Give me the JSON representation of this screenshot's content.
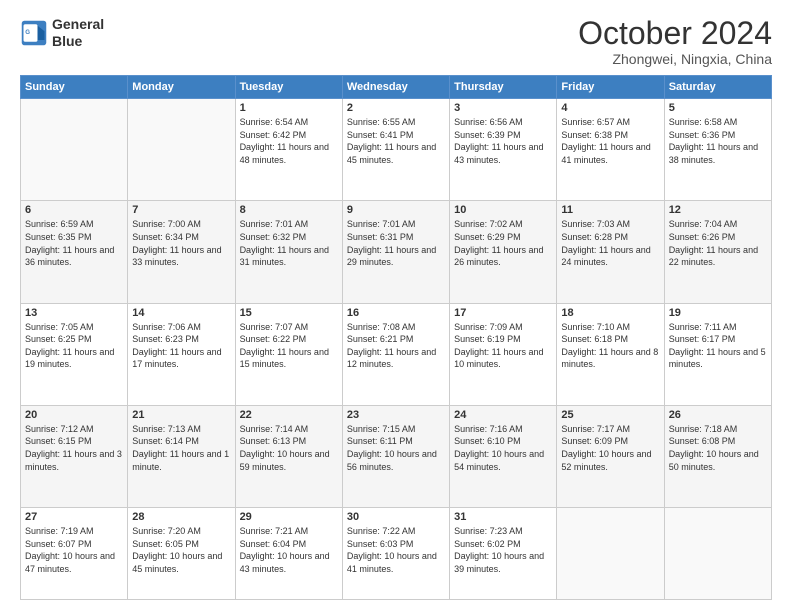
{
  "header": {
    "logo_line1": "General",
    "logo_line2": "Blue",
    "title": "October 2024",
    "location": "Zhongwei, Ningxia, China"
  },
  "days_of_week": [
    "Sunday",
    "Monday",
    "Tuesday",
    "Wednesday",
    "Thursday",
    "Friday",
    "Saturday"
  ],
  "weeks": [
    [
      {
        "day": "",
        "info": ""
      },
      {
        "day": "",
        "info": ""
      },
      {
        "day": "1",
        "info": "Sunrise: 6:54 AM\nSunset: 6:42 PM\nDaylight: 11 hours and 48 minutes."
      },
      {
        "day": "2",
        "info": "Sunrise: 6:55 AM\nSunset: 6:41 PM\nDaylight: 11 hours and 45 minutes."
      },
      {
        "day": "3",
        "info": "Sunrise: 6:56 AM\nSunset: 6:39 PM\nDaylight: 11 hours and 43 minutes."
      },
      {
        "day": "4",
        "info": "Sunrise: 6:57 AM\nSunset: 6:38 PM\nDaylight: 11 hours and 41 minutes."
      },
      {
        "day": "5",
        "info": "Sunrise: 6:58 AM\nSunset: 6:36 PM\nDaylight: 11 hours and 38 minutes."
      }
    ],
    [
      {
        "day": "6",
        "info": "Sunrise: 6:59 AM\nSunset: 6:35 PM\nDaylight: 11 hours and 36 minutes."
      },
      {
        "day": "7",
        "info": "Sunrise: 7:00 AM\nSunset: 6:34 PM\nDaylight: 11 hours and 33 minutes."
      },
      {
        "day": "8",
        "info": "Sunrise: 7:01 AM\nSunset: 6:32 PM\nDaylight: 11 hours and 31 minutes."
      },
      {
        "day": "9",
        "info": "Sunrise: 7:01 AM\nSunset: 6:31 PM\nDaylight: 11 hours and 29 minutes."
      },
      {
        "day": "10",
        "info": "Sunrise: 7:02 AM\nSunset: 6:29 PM\nDaylight: 11 hours and 26 minutes."
      },
      {
        "day": "11",
        "info": "Sunrise: 7:03 AM\nSunset: 6:28 PM\nDaylight: 11 hours and 24 minutes."
      },
      {
        "day": "12",
        "info": "Sunrise: 7:04 AM\nSunset: 6:26 PM\nDaylight: 11 hours and 22 minutes."
      }
    ],
    [
      {
        "day": "13",
        "info": "Sunrise: 7:05 AM\nSunset: 6:25 PM\nDaylight: 11 hours and 19 minutes."
      },
      {
        "day": "14",
        "info": "Sunrise: 7:06 AM\nSunset: 6:23 PM\nDaylight: 11 hours and 17 minutes."
      },
      {
        "day": "15",
        "info": "Sunrise: 7:07 AM\nSunset: 6:22 PM\nDaylight: 11 hours and 15 minutes."
      },
      {
        "day": "16",
        "info": "Sunrise: 7:08 AM\nSunset: 6:21 PM\nDaylight: 11 hours and 12 minutes."
      },
      {
        "day": "17",
        "info": "Sunrise: 7:09 AM\nSunset: 6:19 PM\nDaylight: 11 hours and 10 minutes."
      },
      {
        "day": "18",
        "info": "Sunrise: 7:10 AM\nSunset: 6:18 PM\nDaylight: 11 hours and 8 minutes."
      },
      {
        "day": "19",
        "info": "Sunrise: 7:11 AM\nSunset: 6:17 PM\nDaylight: 11 hours and 5 minutes."
      }
    ],
    [
      {
        "day": "20",
        "info": "Sunrise: 7:12 AM\nSunset: 6:15 PM\nDaylight: 11 hours and 3 minutes."
      },
      {
        "day": "21",
        "info": "Sunrise: 7:13 AM\nSunset: 6:14 PM\nDaylight: 11 hours and 1 minute."
      },
      {
        "day": "22",
        "info": "Sunrise: 7:14 AM\nSunset: 6:13 PM\nDaylight: 10 hours and 59 minutes."
      },
      {
        "day": "23",
        "info": "Sunrise: 7:15 AM\nSunset: 6:11 PM\nDaylight: 10 hours and 56 minutes."
      },
      {
        "day": "24",
        "info": "Sunrise: 7:16 AM\nSunset: 6:10 PM\nDaylight: 10 hours and 54 minutes."
      },
      {
        "day": "25",
        "info": "Sunrise: 7:17 AM\nSunset: 6:09 PM\nDaylight: 10 hours and 52 minutes."
      },
      {
        "day": "26",
        "info": "Sunrise: 7:18 AM\nSunset: 6:08 PM\nDaylight: 10 hours and 50 minutes."
      }
    ],
    [
      {
        "day": "27",
        "info": "Sunrise: 7:19 AM\nSunset: 6:07 PM\nDaylight: 10 hours and 47 minutes."
      },
      {
        "day": "28",
        "info": "Sunrise: 7:20 AM\nSunset: 6:05 PM\nDaylight: 10 hours and 45 minutes."
      },
      {
        "day": "29",
        "info": "Sunrise: 7:21 AM\nSunset: 6:04 PM\nDaylight: 10 hours and 43 minutes."
      },
      {
        "day": "30",
        "info": "Sunrise: 7:22 AM\nSunset: 6:03 PM\nDaylight: 10 hours and 41 minutes."
      },
      {
        "day": "31",
        "info": "Sunrise: 7:23 AM\nSunset: 6:02 PM\nDaylight: 10 hours and 39 minutes."
      },
      {
        "day": "",
        "info": ""
      },
      {
        "day": "",
        "info": ""
      }
    ]
  ]
}
